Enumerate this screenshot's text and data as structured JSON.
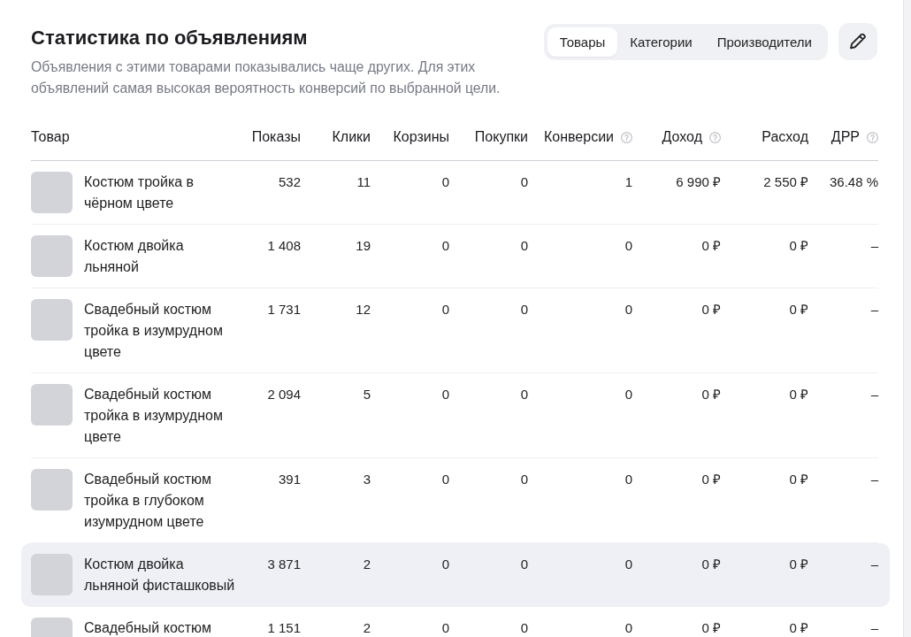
{
  "header": {
    "title": "Статистика по объявлениям",
    "description": "Объявления с этими товарами показывались чаще других. Для этих объявлений самая высокая вероятность конверсий по выбранной цели."
  },
  "tabs": [
    {
      "label": "Товары",
      "selected": true
    },
    {
      "label": "Категории",
      "selected": false
    },
    {
      "label": "Производители",
      "selected": false
    }
  ],
  "table": {
    "columns": [
      {
        "label": "Товар",
        "kind": "plain"
      },
      {
        "label": "Показы",
        "kind": "plain"
      },
      {
        "label": "Клики",
        "kind": "plain"
      },
      {
        "label": "Корзины",
        "kind": "plain"
      },
      {
        "label": "Покупки",
        "kind": "plain"
      },
      {
        "label": "Конверсии",
        "kind": "help"
      },
      {
        "label": "Доход",
        "kind": "help"
      },
      {
        "label": "Расход",
        "kind": "plain"
      },
      {
        "label": "ДРР",
        "kind": "help"
      }
    ],
    "rows": [
      {
        "highlighted": false,
        "cells": [
          "Костюм тройка в чёрном цвете",
          "532",
          "11",
          "0",
          "0",
          "1",
          "6 990 ₽",
          "2 550 ₽",
          "36.48 %"
        ]
      },
      {
        "highlighted": false,
        "cells": [
          "Костюм двойка льняной",
          "1 408",
          "19",
          "0",
          "0",
          "0",
          "0 ₽",
          "0 ₽",
          "–"
        ]
      },
      {
        "highlighted": false,
        "cells": [
          "Свадебный костюм тройка в изумрудном цвете",
          "1 731",
          "12",
          "0",
          "0",
          "0",
          "0 ₽",
          "0 ₽",
          "–"
        ]
      },
      {
        "highlighted": false,
        "cells": [
          "Свадебный костюм тройка в изумрудном цвете",
          "2 094",
          "5",
          "0",
          "0",
          "0",
          "0 ₽",
          "0 ₽",
          "–"
        ]
      },
      {
        "highlighted": false,
        "cells": [
          "Свадебный костюм тройка в глубоком изумрудном цвете",
          "391",
          "3",
          "0",
          "0",
          "0",
          "0 ₽",
          "0 ₽",
          "–"
        ]
      },
      {
        "highlighted": true,
        "cells": [
          "Костюм двойка льняной фисташковый",
          "3 871",
          "2",
          "0",
          "0",
          "0",
          "0 ₽",
          "0 ₽",
          "–"
        ]
      },
      {
        "highlighted": false,
        "cells": [
          "Свадебный костюм",
          "1 151",
          "2",
          "0",
          "0",
          "0",
          "0 ₽",
          "0 ₽",
          "–"
        ]
      }
    ]
  }
}
